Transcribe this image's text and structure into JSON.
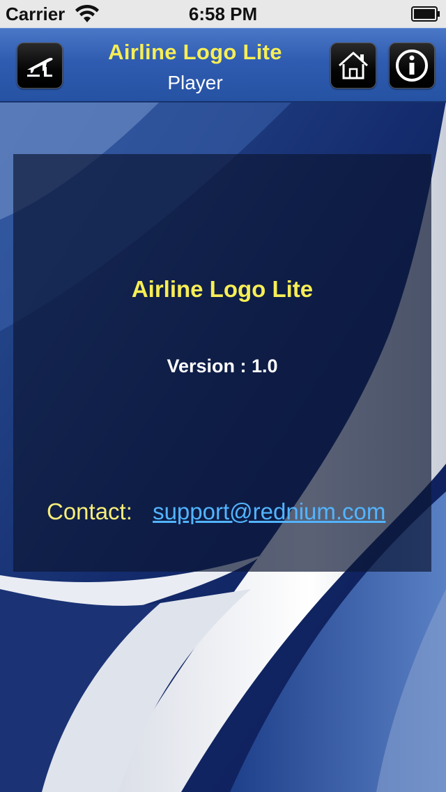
{
  "status_bar": {
    "carrier": "Carrier",
    "time": "6:58 PM",
    "wifi_icon": "wifi-icon",
    "battery_icon": "battery-icon"
  },
  "nav": {
    "title": "Airline Logo Lite",
    "subtitle": "Player",
    "left_button_icon": "flight-board-icon",
    "home_button_icon": "home-icon",
    "info_button_icon": "info-icon"
  },
  "panel": {
    "app_name": "Airline Logo Lite",
    "version_label": "Version : ",
    "version_value": "1.0",
    "contact_label": "Contact:",
    "contact_email": "support@rednium.com"
  },
  "colors": {
    "title_yellow": "#f7ee55",
    "link_blue": "#52b4ff",
    "nav_blue": "#2f5cb0",
    "background_navy": "#0e1f5a"
  }
}
